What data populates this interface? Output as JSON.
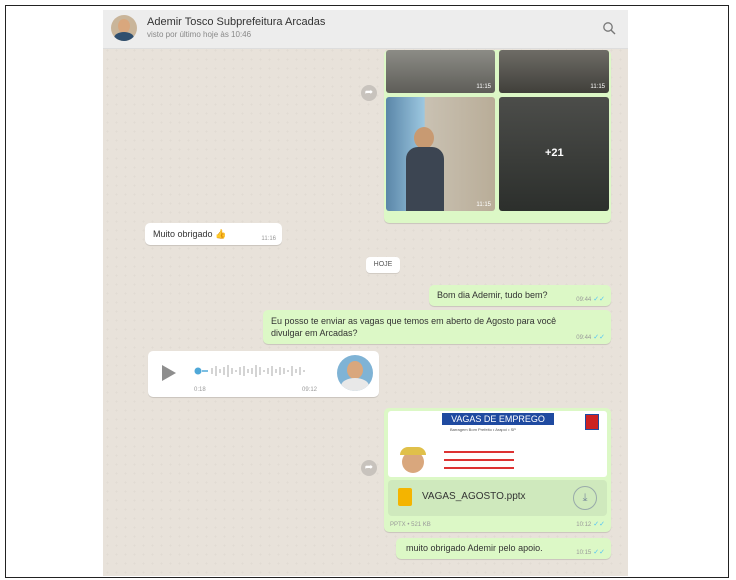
{
  "header": {
    "name": "Ademir Tosco Subprefeitura Arcadas",
    "status": "visto por último hoje às 10:46"
  },
  "photos": {
    "top_left_time": "11:15",
    "top_right_time": "11:15",
    "bottom_left_time": "11:15",
    "more_count": "+21"
  },
  "messages": {
    "thanks": {
      "text": "Muito obrigado 👍",
      "time": "11:16"
    },
    "date_chip": "HOJE",
    "greeting": {
      "text": "Bom dia Ademir, tudo bem?",
      "time": "09:44"
    },
    "vagas_msg": {
      "text": "Eu posso te enviar as vagas que temos em aberto de Agosto para você divulgar em Arcadas?",
      "time": "09:44"
    },
    "audio": {
      "duration": "0:18",
      "time": "09:12"
    },
    "doc": {
      "banner_title": "VAGAS DE EMPREGO",
      "banner_sub": "Barragem Bom Prefeito • Arapoí • SP",
      "filename": "VAGAS_AGOSTO.pptx",
      "meta": "PPTX • 521 KB",
      "time": "10:12"
    },
    "final": {
      "text": "muito obrigado Ademir pelo apoio.",
      "time": "10:15"
    }
  },
  "colors": {
    "outgoing": "#dcf8c6",
    "incoming": "#ffffff",
    "tick": "#4fc3f7",
    "chat_bg": "#e8e2da"
  }
}
